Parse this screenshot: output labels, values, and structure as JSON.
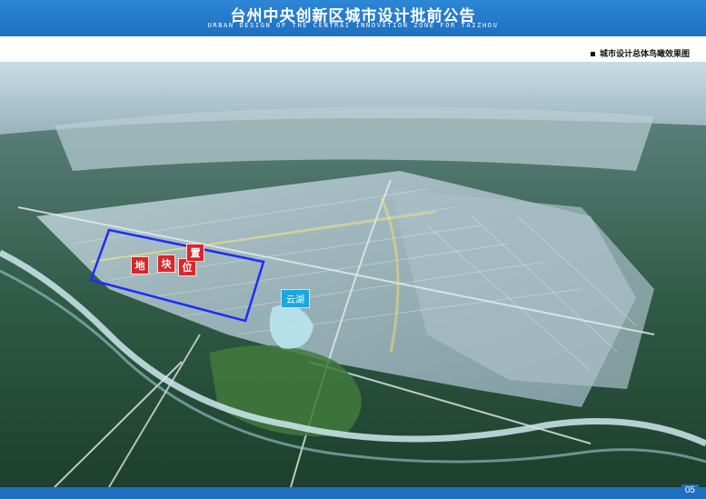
{
  "header": {
    "title": "台州中央创新区城市设计批前公告",
    "subtitle": "URBAN DESIGN OF THE CENTRAI INNOVATION ZONE FOR TAIZHOU"
  },
  "caption": "城市设计总体鸟瞰效果图",
  "site_labels": [
    "地",
    "块",
    "位",
    "置"
  ],
  "lake_label": "云湖",
  "page_number": "05",
  "colors": {
    "brand_blue": "#1f6fc0",
    "site_red": "#d8262b",
    "boundary_blue": "#1d2cff",
    "lake_label_blue": "#1aa7df"
  },
  "icons": [
    "caption-bullet-icon"
  ]
}
